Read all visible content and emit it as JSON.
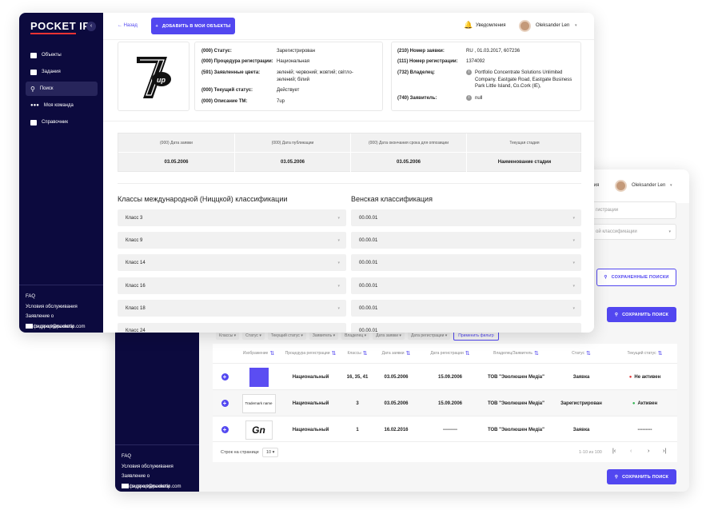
{
  "brand": {
    "name": "POCKET IP",
    "accent": "#5247f0",
    "sidebar_bg": "#0c0a3e",
    "logo_underline": "#e33333"
  },
  "sidebar": {
    "items": [
      {
        "label": "Объекты",
        "icon": "briefcase-icon"
      },
      {
        "label": "Задания",
        "icon": "checkbox-icon"
      },
      {
        "label": "Поиск",
        "icon": "search-icon",
        "active": true
      },
      {
        "label": "Моя команда",
        "icon": "team-icon"
      },
      {
        "label": "Справочник",
        "icon": "book-icon"
      }
    ],
    "footer": {
      "faq": "FAQ",
      "terms": "Условия обслуживания",
      "privacy": "Заявление о конфиденциальности",
      "email": "support@pocketip.com"
    }
  },
  "header": {
    "back": "← Назад",
    "add_button": "ДОБАВИТЬ В МОИ ОБЪЕКТЫ",
    "notifications": "Уведомления",
    "user_name": "Oleksander Len"
  },
  "trademark": {
    "logo_text": "7up",
    "left_card": [
      {
        "k": "(000) Статус:",
        "v": "Зарегистрирован"
      },
      {
        "k": "(000) Процедура регистрации:",
        "v": "Национальная"
      },
      {
        "k": "(591) Заявленные цвета:",
        "v": "зеленій; червоний; жовтий; світло-зелений; білий"
      },
      {
        "k": "(000) Текущий статус:",
        "v": "Действует"
      },
      {
        "k": "(000) Описание ТМ:",
        "v": "7up"
      }
    ],
    "right_card": [
      {
        "k": "(210) Номер заявки:",
        "v": "RU , 01.03.2017, 607236"
      },
      {
        "k": "(111) Номер регистрации:",
        "v": "1374092"
      },
      {
        "k": "(732) Владелец:",
        "v": "Portfolio Concentrate Solutions Unlimited Company. Eastgate Road, Eastgate Business Park Little Island, Co.Cork (IE),"
      },
      {
        "k": "(740) Заявитель:",
        "v": "null"
      }
    ]
  },
  "dates": {
    "headers": [
      "(000) Дата заявки",
      "(000) Дата публикации",
      "(000) Дата окончания срока для оппозиции",
      "Текущая стадия"
    ],
    "values": [
      "03.05.2006",
      "03.05.2006",
      "03.05.2006",
      "Наименование стадии"
    ]
  },
  "nice": {
    "title": "Классы международной (Ниццкой) классификации",
    "items": [
      "Класс 3",
      "Класс 9",
      "Класс 14",
      "Класс 16",
      "Класс 18",
      "Класс 24"
    ]
  },
  "vienna": {
    "title": "Венская классификация",
    "items": [
      "00.00.01",
      "00.00.01",
      "00.00.01",
      "00.00.01",
      "00.00.01",
      "00.00.01"
    ]
  },
  "back": {
    "user_name": "Oleksander Len",
    "user_fragment": "вания",
    "search_placeholder": "гистрации",
    "class_placeholder": "ой классификации",
    "saved_searches": "СОХРАНЕННЫЕ ПОИСКИ",
    "save_search": "СОХРАНИТЬ ПОИСК",
    "filters": [
      "Классы",
      "Статус",
      "Текущий статус",
      "Заявитель",
      "Владелец",
      "Дата заявки",
      "Дата регистрации"
    ],
    "apply_filter": "Применить фильтр",
    "columns": [
      "Изображение",
      "Процедура регистрации",
      "Классы",
      "Дата заявки",
      "Дата регистрации",
      "Владелец/Заявитель",
      "Статус",
      "Текущий статус"
    ],
    "rows": [
      {
        "image": "purple-square",
        "procedure": "Национальный",
        "classes": "16, 35, 41",
        "filed": "03.05.2006",
        "registered": "15.09.2006",
        "owner": "ТОВ \"Эволюшен Медіа\"",
        "status": "Заявка",
        "current": "Не активен",
        "current_color": "#e33333"
      },
      {
        "image": "Trademark name",
        "procedure": "Национальный",
        "classes": "3",
        "filed": "03.05.2006",
        "registered": "15.09.2006",
        "owner": "ТОВ \"Эволюшен Медіа\"",
        "status": "Зарегистрирован",
        "current": "Активен",
        "current_color": "#2bb24c"
      },
      {
        "image": "Gn",
        "procedure": "Национальный",
        "classes": "1",
        "filed": "16.02.2016",
        "registered": "---------",
        "owner": "ТОВ \"Эволюшен Медіа\"",
        "status": "Заявка",
        "current": "---------",
        "current_color": ""
      }
    ],
    "rows_per_page_label": "Строк на странице",
    "rows_per_page": "10",
    "range": "1-10 из 100",
    "footer": {
      "faq": "FAQ",
      "terms": "Условия обслуживания",
      "privacy": "Заявление о конфиденциальности",
      "email": "support@pocketip.com"
    }
  }
}
